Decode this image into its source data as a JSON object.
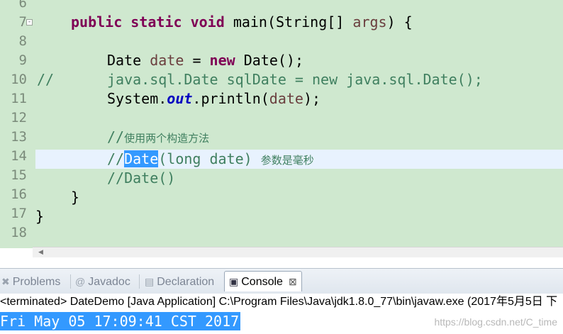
{
  "editor": {
    "line_numbers": [
      "6",
      "7",
      "8",
      "9",
      "10",
      "11",
      "12",
      "13",
      "14",
      "15",
      "16",
      "17",
      "18"
    ],
    "fold_marker": "-",
    "line7": {
      "kw1": "public",
      "kw2": "static",
      "kw3": "void",
      "name": "main(String[]",
      "param": "args",
      "tail": ") {"
    },
    "line9": {
      "type": "Date",
      "var": "date",
      "eq": "=",
      "kw": "new",
      "rest": "Date();"
    },
    "line10": {
      "prefix": "//",
      "text": "java.sql.Date sqlDate = new java.sql.Date();"
    },
    "line11": {
      "pre": "System.",
      "field": "out",
      "mid": ".println(",
      "var": "date",
      "tail": ");"
    },
    "line13": {
      "comment": "//",
      "cjk": "使用两个构造方法"
    },
    "line14": {
      "slashes": "//",
      "selected": "Date",
      "rest": "(long date)",
      "cjk": "参数是毫秒"
    },
    "line15": {
      "comment": "//Date()"
    },
    "line16": {
      "brace": "}"
    },
    "line17": {
      "brace": "}"
    },
    "scroll_left": "◀"
  },
  "tabs": {
    "problems": {
      "icon": "✖",
      "label": "Problems"
    },
    "javadoc": {
      "icon": "@",
      "label": "Javadoc"
    },
    "declaration": {
      "icon": "▤",
      "label": "Declaration"
    },
    "console": {
      "icon": "▣",
      "label": "Console",
      "close": "⊠"
    }
  },
  "console": {
    "header": "<terminated> DateDemo [Java Application] C:\\Program Files\\Java\\jdk1.8.0_77\\bin\\javaw.exe (2017年5月5日 下",
    "output": "Fri May 05 17:09:41 CST 2017"
  },
  "watermark": "https://blog.csdn.net/C_time"
}
